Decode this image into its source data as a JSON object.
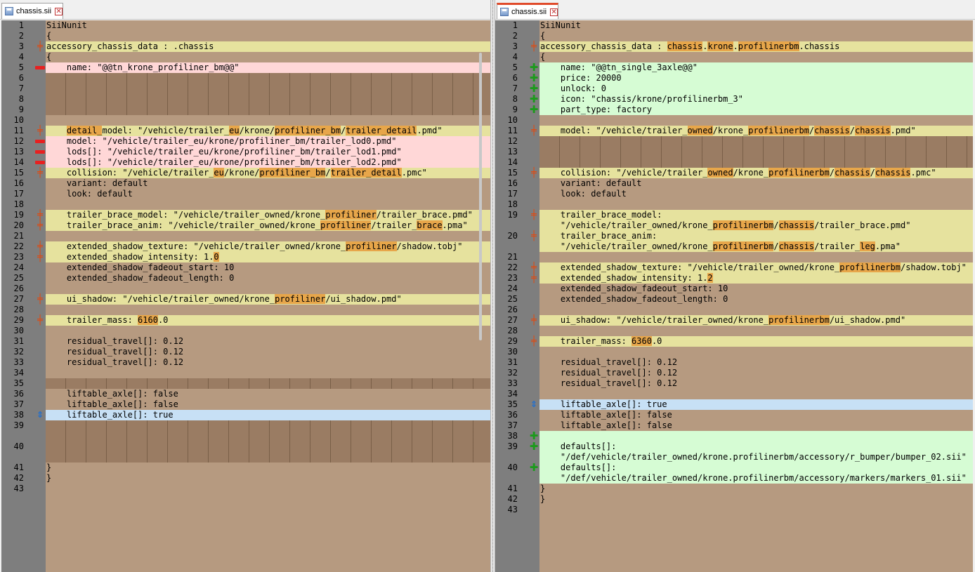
{
  "left": {
    "tab_label": "chassis.sii",
    "close_glyph": "✕",
    "lines": [
      {
        "n": "1",
        "kind": "normal",
        "segs": [
          {
            "t": "SiiNunit"
          }
        ]
      },
      {
        "n": "2",
        "kind": "normal",
        "segs": [
          {
            "t": "{"
          }
        ]
      },
      {
        "n": "3",
        "kind": "change",
        "segs": [
          {
            "t": "accessory_chassis_data : .chassis"
          }
        ]
      },
      {
        "n": "4",
        "kind": "normal",
        "segs": [
          {
            "t": "{"
          }
        ]
      },
      {
        "n": "5",
        "kind": "del",
        "segs": [
          {
            "t": "    name: \"@@tn_krone_profiliner_bm@@\""
          }
        ]
      },
      {
        "n": "6",
        "kind": "gap",
        "segs": []
      },
      {
        "n": "7",
        "kind": "gap",
        "segs": []
      },
      {
        "n": "8",
        "kind": "gap",
        "segs": []
      },
      {
        "n": "9",
        "kind": "gap",
        "segs": []
      },
      {
        "n": "10",
        "kind": "normal",
        "segs": []
      },
      {
        "n": "11",
        "kind": "change",
        "segs": [
          {
            "t": "    "
          },
          {
            "t": "detail_",
            "h": true
          },
          {
            "t": "model: \"/vehicle/trailer_"
          },
          {
            "t": "eu",
            "h": true
          },
          {
            "t": "/krone/"
          },
          {
            "t": "profiliner_bm",
            "h": true
          },
          {
            "t": "/"
          },
          {
            "t": "trailer_detail",
            "h": true
          },
          {
            "t": ".pmd\""
          }
        ]
      },
      {
        "n": "12",
        "kind": "del",
        "segs": [
          {
            "t": "    model: \"/vehicle/trailer_eu/krone/profiliner_bm/trailer_lod0.pmd\""
          }
        ]
      },
      {
        "n": "13",
        "kind": "del",
        "segs": [
          {
            "t": "    lods[]: \"/vehicle/trailer_eu/krone/profiliner_bm/trailer_lod1.pmd\""
          }
        ]
      },
      {
        "n": "14",
        "kind": "del",
        "segs": [
          {
            "t": "    lods[]: \"/vehicle/trailer_eu/krone/profiliner_bm/trailer_lod2.pmd\""
          }
        ]
      },
      {
        "n": "15",
        "kind": "change",
        "segs": [
          {
            "t": "    collision: \"/vehicle/trailer_"
          },
          {
            "t": "eu",
            "h": true
          },
          {
            "t": "/krone/"
          },
          {
            "t": "profiliner_bm",
            "h": true
          },
          {
            "t": "/"
          },
          {
            "t": "trailer_detail",
            "h": true
          },
          {
            "t": ".pmc\""
          }
        ]
      },
      {
        "n": "16",
        "kind": "normal",
        "segs": [
          {
            "t": "    variant: default"
          }
        ]
      },
      {
        "n": "17",
        "kind": "normal",
        "segs": [
          {
            "t": "    look: default"
          }
        ]
      },
      {
        "n": "18",
        "kind": "normal",
        "segs": []
      },
      {
        "n": "19",
        "kind": "change",
        "segs": [
          {
            "t": "    trailer_brace_model: \"/vehicle/trailer_owned/krone_"
          },
          {
            "t": "profiliner",
            "h": true
          },
          {
            "t": "/trailer_brace.pmd\""
          }
        ]
      },
      {
        "n": "20",
        "kind": "change",
        "segs": [
          {
            "t": "    trailer_brace_anim: \"/vehicle/trailer_owned/krone_"
          },
          {
            "t": "profiliner",
            "h": true
          },
          {
            "t": "/trailer_"
          },
          {
            "t": "brace",
            "h": true
          },
          {
            "t": ".pma\""
          }
        ]
      },
      {
        "n": "21",
        "kind": "normal",
        "segs": []
      },
      {
        "n": "22",
        "kind": "change",
        "segs": [
          {
            "t": "    extended_shadow_texture: \"/vehicle/trailer_owned/krone_"
          },
          {
            "t": "profiliner",
            "h": true
          },
          {
            "t": "/shadow.tobj\""
          }
        ]
      },
      {
        "n": "23",
        "kind": "change",
        "segs": [
          {
            "t": "    extended_shadow_intensity: 1."
          },
          {
            "t": "0",
            "h": true
          }
        ]
      },
      {
        "n": "24",
        "kind": "normal",
        "segs": [
          {
            "t": "    extended_shadow_fadeout_start: 10"
          }
        ]
      },
      {
        "n": "25",
        "kind": "normal",
        "segs": [
          {
            "t": "    extended_shadow_fadeout_length: 0"
          }
        ]
      },
      {
        "n": "26",
        "kind": "normal",
        "segs": []
      },
      {
        "n": "27",
        "kind": "change",
        "segs": [
          {
            "t": "    ui_shadow: \"/vehicle/trailer_owned/krone_"
          },
          {
            "t": "profiliner",
            "h": true
          },
          {
            "t": "/ui_shadow.pmd\""
          }
        ]
      },
      {
        "n": "28",
        "kind": "normal",
        "segs": []
      },
      {
        "n": "29",
        "kind": "change",
        "segs": [
          {
            "t": "    trailer_mass: "
          },
          {
            "t": "6160",
            "h": true
          },
          {
            "t": ".0"
          }
        ]
      },
      {
        "n": "30",
        "kind": "normal",
        "segs": []
      },
      {
        "n": "31",
        "kind": "normal",
        "segs": [
          {
            "t": "    residual_travel[]: 0.12"
          }
        ]
      },
      {
        "n": "32",
        "kind": "normal",
        "segs": [
          {
            "t": "    residual_travel[]: 0.12"
          }
        ]
      },
      {
        "n": "33",
        "kind": "normal",
        "segs": [
          {
            "t": "    residual_travel[]: 0.12"
          }
        ]
      },
      {
        "n": "34",
        "kind": "normal",
        "segs": []
      },
      {
        "n": "35",
        "kind": "gap",
        "segs": []
      },
      {
        "n": "36",
        "kind": "normal",
        "segs": [
          {
            "t": "    liftable_axle[]: false"
          }
        ]
      },
      {
        "n": "37",
        "kind": "normal",
        "segs": [
          {
            "t": "    liftable_axle[]: false"
          }
        ]
      },
      {
        "n": "38",
        "kind": "moved",
        "segs": [
          {
            "t": "    liftable_axle[]: true"
          }
        ]
      },
      {
        "n": "39",
        "kind": "gap",
        "tall": true,
        "segs": []
      },
      {
        "n": "40",
        "kind": "gap",
        "tall": true,
        "segs": []
      },
      {
        "n": "41",
        "kind": "normal",
        "segs": [
          {
            "t": "}"
          }
        ]
      },
      {
        "n": "42",
        "kind": "normal",
        "segs": [
          {
            "t": "}"
          }
        ]
      },
      {
        "n": "43",
        "kind": "normal",
        "segs": []
      }
    ]
  },
  "right": {
    "tab_label": "chassis.sii",
    "close_glyph": "✕",
    "lines": [
      {
        "n": "1",
        "kind": "normal",
        "segs": [
          {
            "t": "SiiNunit"
          }
        ]
      },
      {
        "n": "2",
        "kind": "normal",
        "segs": [
          {
            "t": "{"
          }
        ]
      },
      {
        "n": "3",
        "kind": "change",
        "segs": [
          {
            "t": "accessory_chassis_data : "
          },
          {
            "t": "chassis",
            "h": true
          },
          {
            "t": "."
          },
          {
            "t": "krone",
            "h": true
          },
          {
            "t": "."
          },
          {
            "t": "profilinerbm",
            "h": true
          },
          {
            "t": ".chassis"
          }
        ]
      },
      {
        "n": "4",
        "kind": "normal",
        "segs": [
          {
            "t": "{"
          }
        ]
      },
      {
        "n": "5",
        "kind": "add",
        "segs": [
          {
            "t": "    name: \"@@tn_single_3axle@@\""
          }
        ]
      },
      {
        "n": "6",
        "kind": "add",
        "segs": [
          {
            "t": "    price: 20000"
          }
        ]
      },
      {
        "n": "7",
        "kind": "add",
        "segs": [
          {
            "t": "    unlock: 0"
          }
        ]
      },
      {
        "n": "8",
        "kind": "add",
        "segs": [
          {
            "t": "    icon: \"chassis/krone/profilinerbm_3\""
          }
        ]
      },
      {
        "n": "9",
        "kind": "add",
        "segs": [
          {
            "t": "    part_type: factory"
          }
        ]
      },
      {
        "n": "10",
        "kind": "normal",
        "segs": []
      },
      {
        "n": "11",
        "kind": "change",
        "segs": [
          {
            "t": "    model: \"/vehicle/trailer_"
          },
          {
            "t": "owned",
            "h": true
          },
          {
            "t": "/krone_"
          },
          {
            "t": "profilinerbm",
            "h": true
          },
          {
            "t": "/"
          },
          {
            "t": "chassis",
            "h": true
          },
          {
            "t": "/"
          },
          {
            "t": "chassis",
            "h": true
          },
          {
            "t": ".pmd\""
          }
        ]
      },
      {
        "n": "12",
        "kind": "gap",
        "segs": []
      },
      {
        "n": "13",
        "kind": "gap",
        "segs": []
      },
      {
        "n": "14",
        "kind": "gap",
        "segs": []
      },
      {
        "n": "15",
        "kind": "change",
        "segs": [
          {
            "t": "    collision: \"/vehicle/trailer_"
          },
          {
            "t": "owned",
            "h": true
          },
          {
            "t": "/krone_"
          },
          {
            "t": "profilinerbm",
            "h": true
          },
          {
            "t": "/"
          },
          {
            "t": "chassis",
            "h": true
          },
          {
            "t": "/"
          },
          {
            "t": "chassis",
            "h": true
          },
          {
            "t": ".pmc\""
          }
        ]
      },
      {
        "n": "16",
        "kind": "normal",
        "segs": [
          {
            "t": "    variant: default"
          }
        ]
      },
      {
        "n": "17",
        "kind": "normal",
        "segs": [
          {
            "t": "    look: default"
          }
        ]
      },
      {
        "n": "18",
        "kind": "normal",
        "segs": []
      },
      {
        "n": "19",
        "kind": "change",
        "tall": true,
        "segs": [
          {
            "t": "    trailer_brace_model:\n    \"/vehicle/trailer_owned/krone_"
          },
          {
            "t": "profilinerbm",
            "h": true
          },
          {
            "t": "/"
          },
          {
            "t": "chassis",
            "h": true
          },
          {
            "t": "/trailer_brace.pmd\""
          }
        ]
      },
      {
        "n": "20",
        "kind": "change",
        "tall": true,
        "segs": [
          {
            "t": "    trailer_brace_anim:\n    \"/vehicle/trailer_owned/krone_"
          },
          {
            "t": "profilinerbm",
            "h": true
          },
          {
            "t": "/"
          },
          {
            "t": "chassis",
            "h": true
          },
          {
            "t": "/trailer_"
          },
          {
            "t": "leg",
            "h": true
          },
          {
            "t": ".pma\""
          }
        ]
      },
      {
        "n": "21",
        "kind": "normal",
        "segs": []
      },
      {
        "n": "22",
        "kind": "change",
        "segs": [
          {
            "t": "    extended_shadow_texture: \"/vehicle/trailer_owned/krone_"
          },
          {
            "t": "profilinerbm",
            "h": true
          },
          {
            "t": "/shadow.tobj\""
          }
        ]
      },
      {
        "n": "23",
        "kind": "change",
        "segs": [
          {
            "t": "    extended_shadow_intensity: 1."
          },
          {
            "t": "2",
            "h": true
          }
        ]
      },
      {
        "n": "24",
        "kind": "normal",
        "segs": [
          {
            "t": "    extended_shadow_fadeout_start: 10"
          }
        ]
      },
      {
        "n": "25",
        "kind": "normal",
        "segs": [
          {
            "t": "    extended_shadow_fadeout_length: 0"
          }
        ]
      },
      {
        "n": "26",
        "kind": "normal",
        "segs": []
      },
      {
        "n": "27",
        "kind": "change",
        "segs": [
          {
            "t": "    ui_shadow: \"/vehicle/trailer_owned/krone_"
          },
          {
            "t": "profilinerbm",
            "h": true
          },
          {
            "t": "/ui_shadow.pmd\""
          }
        ]
      },
      {
        "n": "28",
        "kind": "normal",
        "segs": []
      },
      {
        "n": "29",
        "kind": "change",
        "segs": [
          {
            "t": "    trailer_mass: "
          },
          {
            "t": "6360",
            "h": true
          },
          {
            "t": ".0"
          }
        ]
      },
      {
        "n": "30",
        "kind": "normal",
        "segs": []
      },
      {
        "n": "31",
        "kind": "normal",
        "segs": [
          {
            "t": "    residual_travel[]: 0.12"
          }
        ]
      },
      {
        "n": "32",
        "kind": "normal",
        "segs": [
          {
            "t": "    residual_travel[]: 0.12"
          }
        ]
      },
      {
        "n": "33",
        "kind": "normal",
        "segs": [
          {
            "t": "    residual_travel[]: 0.12"
          }
        ]
      },
      {
        "n": "34",
        "kind": "normal",
        "segs": []
      },
      {
        "n": "35",
        "kind": "moved",
        "segs": [
          {
            "t": "    liftable_axle[]: true"
          }
        ]
      },
      {
        "n": "36",
        "kind": "normal",
        "segs": [
          {
            "t": "    liftable_axle[]: false"
          }
        ]
      },
      {
        "n": "37",
        "kind": "normal",
        "segs": [
          {
            "t": "    liftable_axle[]: false"
          }
        ]
      },
      {
        "n": "38",
        "kind": "add",
        "segs": []
      },
      {
        "n": "39",
        "kind": "add",
        "tall": true,
        "segs": [
          {
            "t": "    defaults[]:\n    \"/def/vehicle/trailer_owned/krone.profilinerbm/accessory/r_bumper/bumper_02.sii\""
          }
        ]
      },
      {
        "n": "40",
        "kind": "add",
        "tall": true,
        "segs": [
          {
            "t": "    defaults[]:\n    \"/def/vehicle/trailer_owned/krone.profilinerbm/accessory/markers/markers_01.sii\""
          }
        ]
      },
      {
        "n": "41",
        "kind": "normal",
        "segs": [
          {
            "t": "}"
          }
        ]
      },
      {
        "n": "42",
        "kind": "normal",
        "segs": [
          {
            "t": "}"
          }
        ]
      },
      {
        "n": "43",
        "kind": "normal",
        "segs": []
      }
    ]
  },
  "markers": {
    "change": {
      "icon": "change-icon",
      "glyph": "╪"
    },
    "del": {
      "icon": "removed-line-icon",
      "glyph": ""
    },
    "add": {
      "icon": "added-line-icon",
      "glyph": "✚"
    },
    "moved": {
      "icon": "moved-line-icon",
      "glyph": "⇕"
    }
  }
}
